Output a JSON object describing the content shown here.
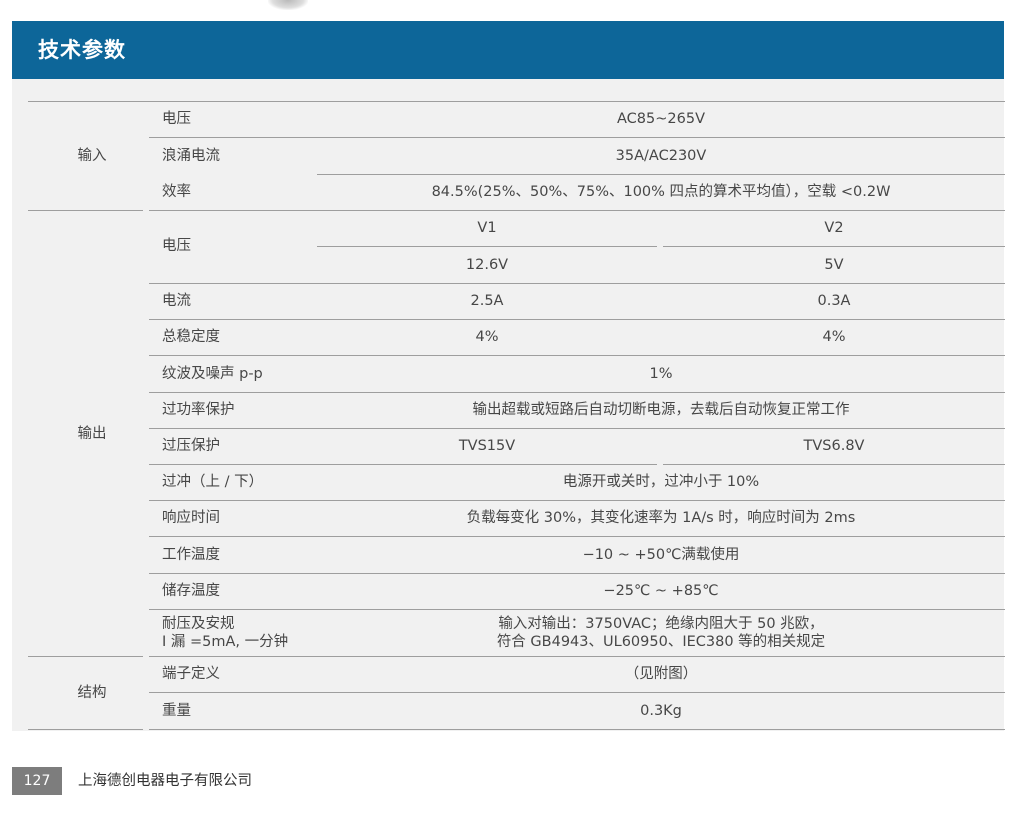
{
  "page_title": "技术参数",
  "groups": {
    "input": "输入",
    "output": "输出",
    "structure": "结构"
  },
  "rows": {
    "in_voltage": {
      "label": "电压",
      "value": "AC85~265V"
    },
    "in_surge": {
      "label": "浪涌电流",
      "value": "35A/AC230V"
    },
    "in_eff": {
      "label": "效率",
      "value": "84.5%(25%、50%、75%、100% 四点的算术平均值），空载 <0.2W"
    },
    "out_voltage": {
      "label": "电压",
      "h1": "V1",
      "h2": "V2",
      "v1": "12.6V",
      "v2": "5V"
    },
    "out_current": {
      "label": "电流",
      "v1": "2.5A",
      "v2": "0.3A"
    },
    "stability": {
      "label": "总稳定度",
      "v1": "4%",
      "v2": "4%"
    },
    "ripple": {
      "label": "纹波及噪声 p-p",
      "value": "1%"
    },
    "overpower": {
      "label": "过功率保护",
      "value": "输出超载或短路后自动切断电源，去载后自动恢复正常工作"
    },
    "overvoltage": {
      "label": "过压保护",
      "v1": "TVS15V",
      "v2": "TVS6.8V"
    },
    "overshoot": {
      "label": "过冲（上 / 下）",
      "value": "电源开或关时，过冲小于 10%"
    },
    "response": {
      "label": "响应时间",
      "value": "负载每变化 30%，其变化速率为 1A/s 时，响应时间为 2ms"
    },
    "work_temp": {
      "label": "工作温度",
      "value": "−10 ~ +50℃满载使用"
    },
    "storage_temp": {
      "label": "储存温度",
      "value": "−25℃ ~ +85℃"
    },
    "withstand": {
      "label1": "耐压及安规",
      "label2": "I 漏 =5mA, 一分钟",
      "value1": "输入对输出：3750VAC；绝缘内阻大于 50 兆欧，",
      "value2": "符合 GB4943、UL60950、IEC380 等的相关规定"
    },
    "terminal": {
      "label": "端子定义",
      "value": "（见附图）"
    },
    "weight": {
      "label": "重量",
      "value": "0.3Kg"
    }
  },
  "footer": {
    "page_number": "127",
    "company": "上海德创电器电子有限公司"
  }
}
